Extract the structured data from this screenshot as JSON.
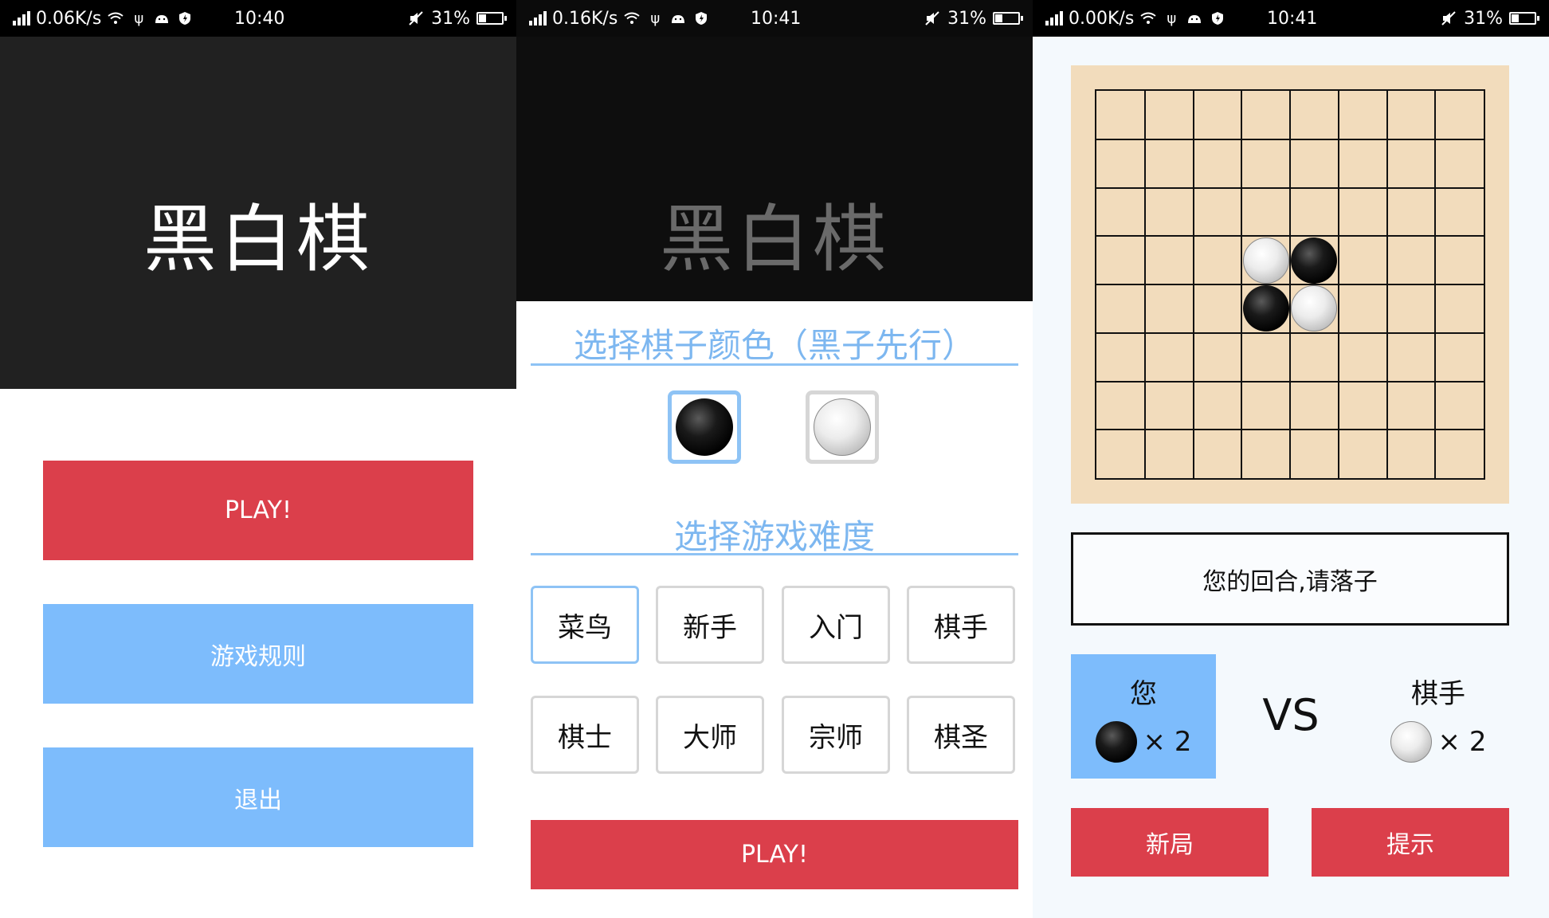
{
  "screens": {
    "home": {
      "status": {
        "speed": "0.06K/s",
        "time": "10:40",
        "battery": "31%"
      },
      "title": "黑白棋",
      "buttons": {
        "play": "PLAY!",
        "rules": "游戏规则",
        "quit": "退出"
      }
    },
    "setup": {
      "status": {
        "speed": "0.16K/s",
        "time": "10:41",
        "battery": "31%"
      },
      "title": "黑白棋",
      "color_section": "选择棋子颜色（黑子先行）",
      "color_selected": "black",
      "difficulty_section": "选择游戏难度",
      "difficulties": [
        "菜鸟",
        "新手",
        "入门",
        "棋手",
        "棋士",
        "大师",
        "宗师",
        "棋圣"
      ],
      "difficulty_selected": "菜鸟",
      "play": "PLAY!"
    },
    "game": {
      "status": {
        "speed": "0.00K/s",
        "time": "10:41",
        "battery": "31%"
      },
      "board_size": 8,
      "stones": [
        {
          "row": 3,
          "col": 3,
          "color": "white"
        },
        {
          "row": 3,
          "col": 4,
          "color": "black"
        },
        {
          "row": 4,
          "col": 3,
          "color": "black"
        },
        {
          "row": 4,
          "col": 4,
          "color": "white"
        }
      ],
      "message": "您的回合,请落子",
      "player": {
        "name": "您",
        "color": "black",
        "count": "× 2"
      },
      "vs": "VS",
      "opponent": {
        "name": "棋手",
        "color": "white",
        "count": "× 2"
      },
      "buttons": {
        "new_game": "新局",
        "hint": "提示"
      }
    }
  },
  "colors": {
    "red": "#db3f4b",
    "blue": "#7dbcfc",
    "board": "#f2dcbc"
  }
}
